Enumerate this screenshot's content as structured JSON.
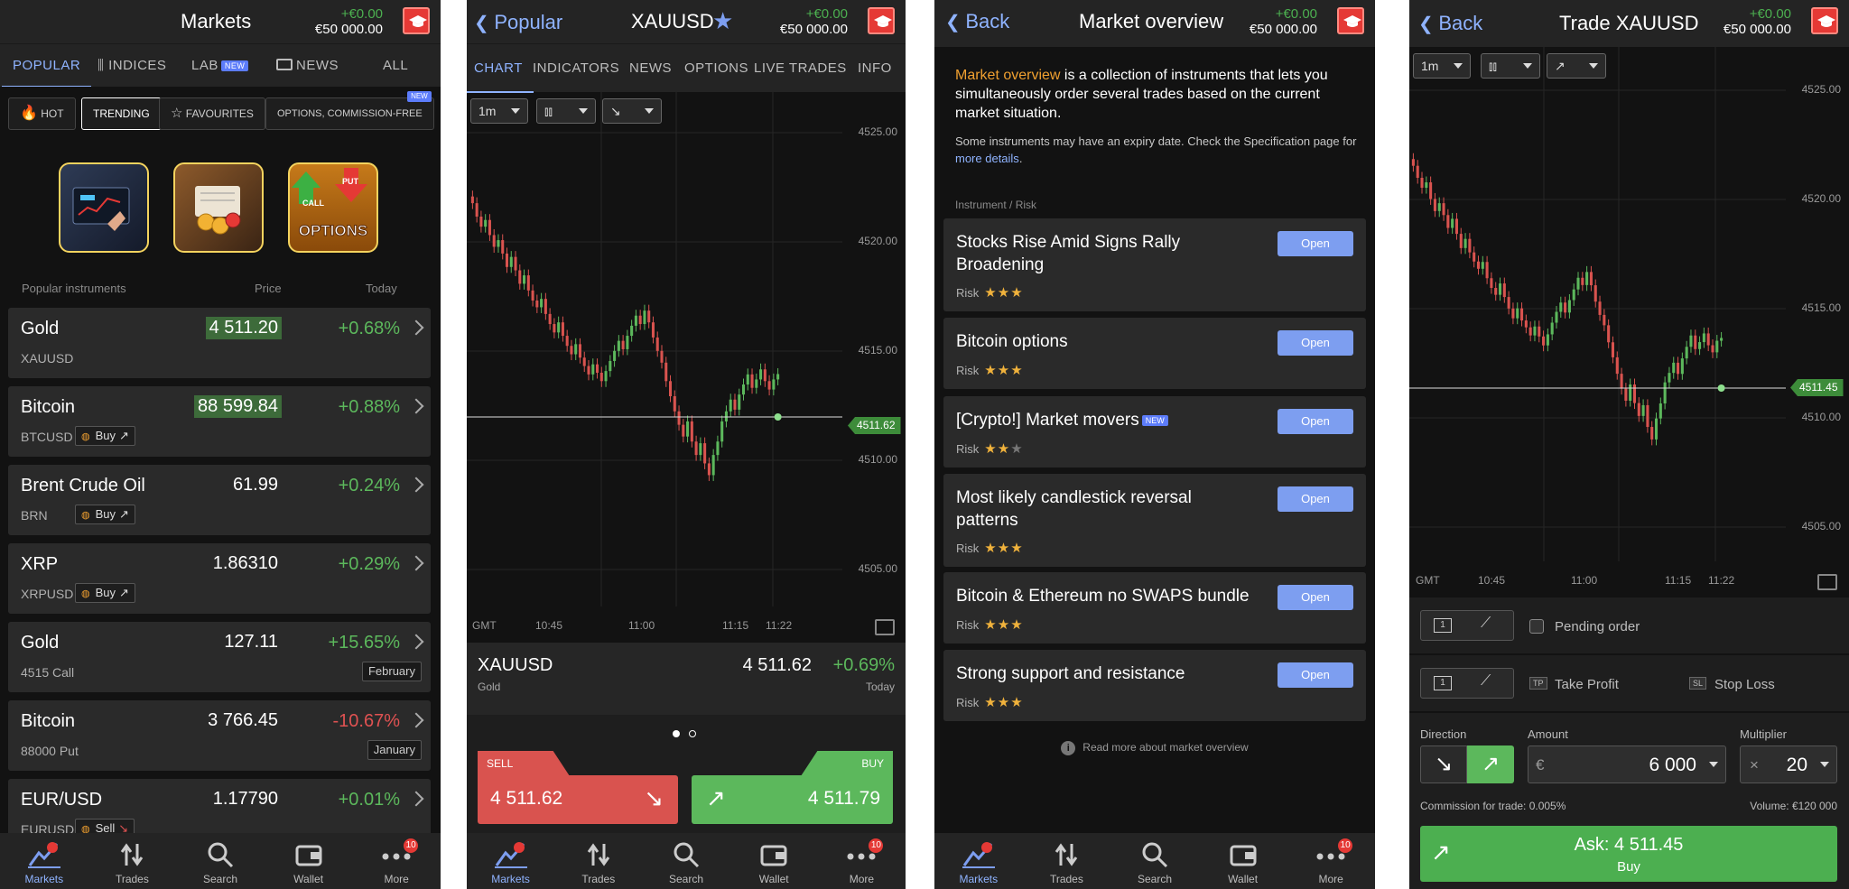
{
  "balance": {
    "pnl": "+€0.00",
    "amount": "€50 000.00"
  },
  "nav": [
    {
      "label": "Markets",
      "icon": "markets-icon"
    },
    {
      "label": "Trades",
      "icon": "trades-icon"
    },
    {
      "label": "Search",
      "icon": "search-icon"
    },
    {
      "label": "Wallet",
      "icon": "wallet-icon"
    },
    {
      "label": "More",
      "icon": "more-icon",
      "badge": "10"
    }
  ],
  "markets": {
    "title": "Markets",
    "tabs": [
      "POPULAR",
      "INDICES",
      "LAB",
      "NEWS",
      "ALL"
    ],
    "tab_new_badge": "NEW",
    "chips": [
      "HOT",
      "TRENDING",
      "FAVOURITES",
      "OPTIONS, COMMISSION-FREE"
    ],
    "chip_new_badge": "NEW",
    "promo_options_text": "OPTIONS",
    "promo_call": "CALL",
    "promo_put": "PUT",
    "list_header": {
      "name": "Popular instruments",
      "price": "Price",
      "today": "Today"
    },
    "rows": [
      {
        "name": "Gold",
        "symbol": "XAUUSD",
        "price": "4 511.20",
        "change": "+0.68%",
        "dir": "up",
        "highlight": true
      },
      {
        "name": "Bitcoin",
        "symbol": "BTCUSD",
        "price": "88 599.84",
        "change": "+0.88%",
        "dir": "up",
        "highlight": true,
        "signal": "Buy"
      },
      {
        "name": "Brent Crude Oil",
        "symbol": "BRN",
        "price": "61.99",
        "change": "+0.24%",
        "dir": "up",
        "signal": "Buy"
      },
      {
        "name": "XRP",
        "symbol": "XRPUSD",
        "price": "1.86310",
        "change": "+0.29%",
        "dir": "up",
        "signal": "Buy"
      },
      {
        "name": "Gold",
        "symbol": "4515 Call",
        "price": "127.11",
        "change": "+15.65%",
        "dir": "up",
        "badge": "February"
      },
      {
        "name": "Bitcoin",
        "symbol": "88000 Put",
        "price": "3 766.45",
        "change": "-10.67%",
        "dir": "down",
        "badge": "January"
      },
      {
        "name": "EUR/USD",
        "symbol": "EURUSD",
        "price": "1.17790",
        "change": "+0.01%",
        "dir": "up",
        "signal": "Sell"
      }
    ]
  },
  "chart": {
    "back_label": "Popular",
    "title": "XAUUSD",
    "tabs": [
      "CHART",
      "INDICATORS",
      "NEWS",
      "OPTIONS",
      "LIVE TRADES",
      "INFO"
    ],
    "timeframe": "1m",
    "yticks": [
      "4525.00",
      "4520.00",
      "4515.00",
      "4510.00",
      "4505.00"
    ],
    "xticks": [
      "GMT",
      "10:45",
      "11:00",
      "11:15",
      "11:22"
    ],
    "current_price": "4511.62",
    "symbol": "XAUUSD",
    "name": "Gold",
    "price": "4 511.62",
    "change": "+0.69%",
    "period": "Today",
    "sell_label": "SELL",
    "sell_price": "4 511.62",
    "buy_label": "BUY",
    "buy_price": "4 511.79"
  },
  "overview": {
    "back_label": "Back",
    "title": "Market overview",
    "intro_link": "Market overview",
    "intro_rest": " is a collection of instruments that lets you simultaneously order several trades based on the current market situation.",
    "note": "Some instruments may have an expiry date. Check the Specification page for ",
    "note_link": "more details",
    "note_end": ".",
    "header": "Instrument / Risk",
    "risk_label": "Risk",
    "open_label": "Open",
    "new_badge": "NEW",
    "items": [
      {
        "title": "Stocks Rise Amid Signs Rally Broadening",
        "risk": 3
      },
      {
        "title": "Bitcoin options",
        "risk": 3
      },
      {
        "title": "[Crypto!] Market movers",
        "risk": 2,
        "new": true
      },
      {
        "title": "Most likely candlestick reversal patterns",
        "risk": 3
      },
      {
        "title": "Bitcoin & Ethereum no SWAPS bundle",
        "risk": 3
      },
      {
        "title": "Strong support and resistance",
        "risk": 3
      }
    ],
    "footer": "Read more about market overview"
  },
  "trade": {
    "back_label": "Back",
    "title": "Trade XAUUSD",
    "timeframe": "1m",
    "yticks": [
      "4525.00",
      "4520.00",
      "4515.00",
      "4510.00",
      "4505.00"
    ],
    "xticks": [
      "GMT",
      "10:45",
      "11:00",
      "11:15",
      "11:22"
    ],
    "current_price": "4511.45",
    "pending_label": "Pending order",
    "tp_badge": "TP",
    "tp_label": "Take Profit",
    "sl_badge": "SL",
    "sl_label": "Stop Loss",
    "direction_label": "Direction",
    "amount_label": "Amount",
    "multiplier_label": "Multiplier",
    "currency": "€",
    "amount": "6 000",
    "mult_sign": "×",
    "multiplier": "20",
    "commission": "Commission for trade: 0.005%",
    "volume": "Volume: €120 000",
    "ask": "Ask: 4 511.45",
    "buy": "Buy"
  }
}
